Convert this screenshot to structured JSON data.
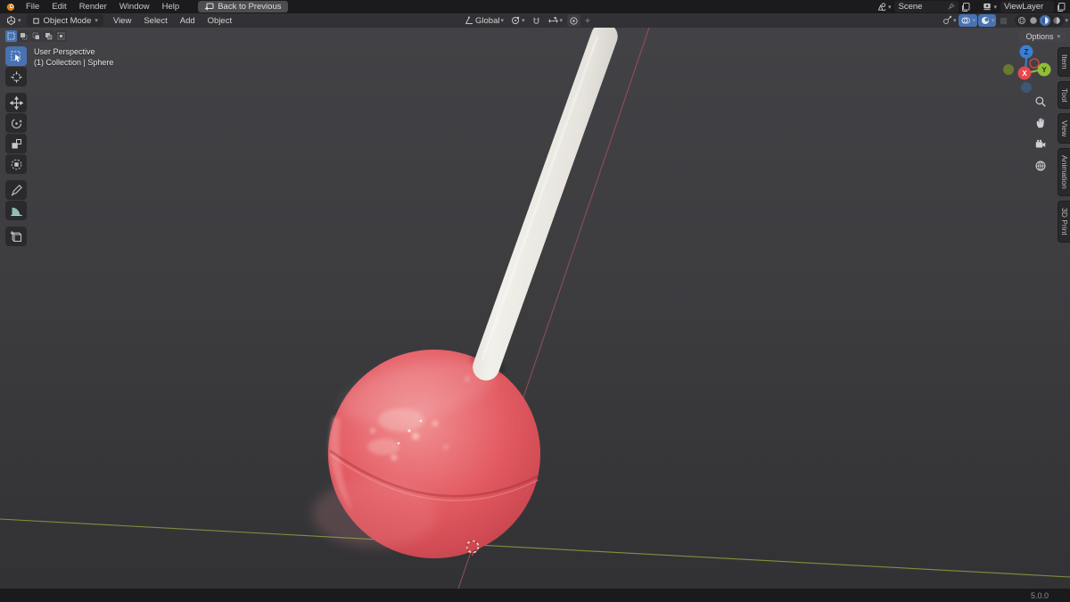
{
  "topbar": {
    "menus": [
      "File",
      "Edit",
      "Render",
      "Window",
      "Help"
    ],
    "back_button_label": "Back to Previous",
    "scene": {
      "label": "Scene"
    },
    "viewlayer": {
      "label": "ViewLayer"
    }
  },
  "viewport_header": {
    "mode_label": "Object Mode",
    "menus": [
      "View",
      "Select",
      "Add",
      "Object"
    ],
    "orientation_label": "Global"
  },
  "tool_settings": {
    "options_label": "Options"
  },
  "viewport": {
    "overlay": {
      "line1": "User Perspective",
      "line2": "(1) Collection | Sphere"
    },
    "gizmo": {
      "x": "X",
      "y": "Y",
      "z": "Z"
    },
    "side_tabs": [
      "Item",
      "Tool",
      "View",
      "Animation",
      "3D Print"
    ]
  },
  "status_bar": {
    "version": "5.0.0"
  },
  "colors": {
    "accent_blue": "#4772b3",
    "candy_red": "#e25b60",
    "stick_white": "#eceae5",
    "axis_green_y": "#8aa33f",
    "axis_red_x": "#a85560",
    "gizmo_x": "#e5484d",
    "gizmo_y": "#8fbe37",
    "gizmo_z": "#3a7fd2"
  }
}
